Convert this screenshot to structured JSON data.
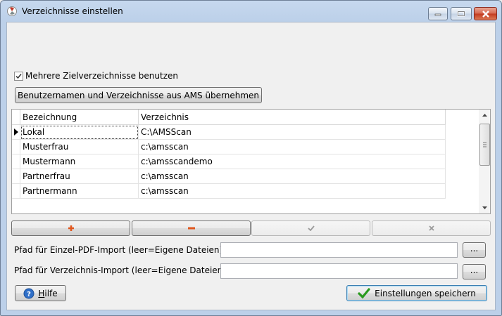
{
  "window": {
    "title": "Verzeichnisse einstellen",
    "controls": {
      "minimize": "minimize-icon",
      "maximize": "maximize-icon",
      "close": "close-icon"
    }
  },
  "options": {
    "multi_dirs_checkbox": {
      "label": "Mehrere Zielverzeichnisse benutzen",
      "checked": true
    },
    "import_ams_button": "Benutzernamen und Verzeichnisse aus AMS übernehmen"
  },
  "grid": {
    "columns": [
      "Bezeichnung",
      "Verzeichnis"
    ],
    "rows": [
      {
        "name": "Lokal",
        "path": "C:\\AMSScan",
        "current": true
      },
      {
        "name": "Musterfrau",
        "path": "c:\\amsscan",
        "current": false
      },
      {
        "name": "Mustermann",
        "path": "c:\\amsscandemo",
        "current": false
      },
      {
        "name": "Partnerfrau",
        "path": "c:\\amsscan",
        "current": false
      },
      {
        "name": "Partnermann",
        "path": "c:\\amsscan",
        "current": false
      }
    ],
    "current_row_marker": "▶"
  },
  "navigator": {
    "add": {
      "symbol": "+",
      "icon": "plus-icon",
      "enabled": true
    },
    "delete": {
      "symbol": "−",
      "icon": "minus-icon",
      "enabled": true
    },
    "post": {
      "symbol": "✔",
      "icon": "check-icon",
      "enabled": false
    },
    "cancel": {
      "symbol": "✕",
      "icon": "x-icon",
      "enabled": false
    }
  },
  "paths": {
    "pdf_import": {
      "label": "Pfad für Einzel-PDF-Import (leer=Eigene Dateien)",
      "value": "",
      "browse": "..."
    },
    "dir_import": {
      "label": "Pfad für Verzeichnis-Import (leer=Eigene Dateien)",
      "value": "",
      "browse": "..."
    }
  },
  "footer": {
    "help_label": "Hilfe",
    "help_accel": "H",
    "help_rest": "ilfe",
    "save_label": "Einstellungen speichern"
  },
  "colors": {
    "add_icon": "#e0571e",
    "delete_icon": "#e0571e",
    "save_check": "#2a9a1f",
    "help_icon": "#2f6fc8"
  }
}
